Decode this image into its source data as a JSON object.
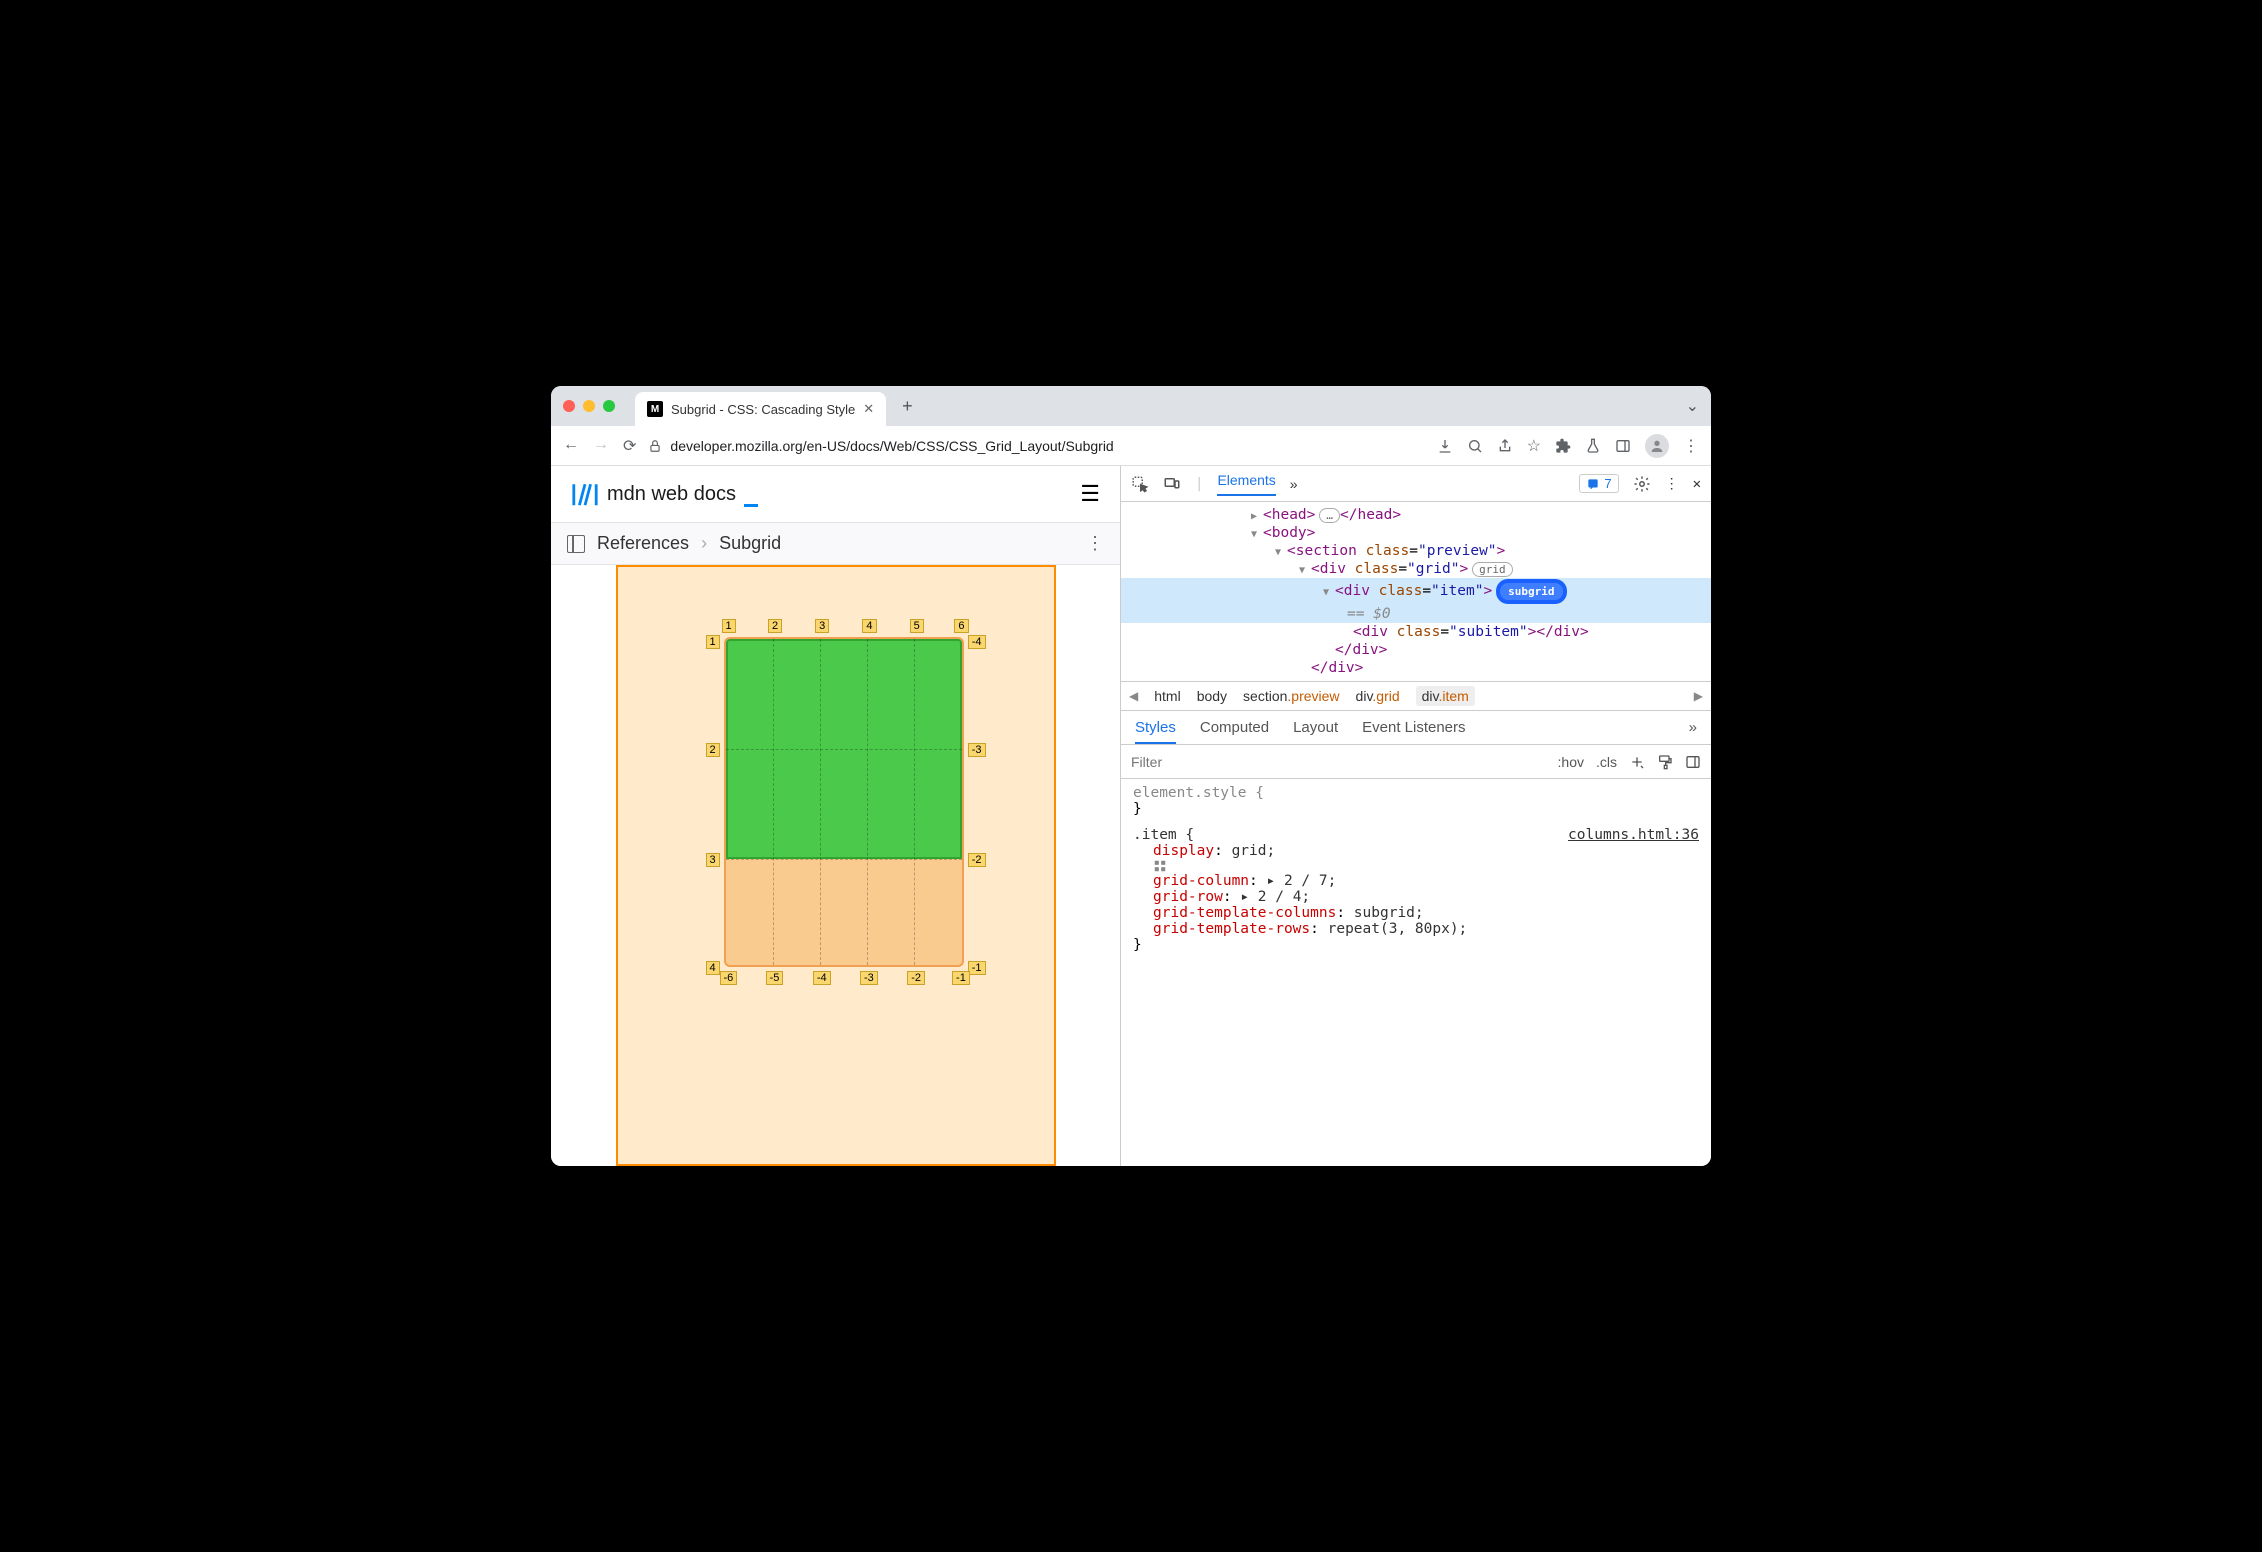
{
  "tab": {
    "title": "Subgrid - CSS: Cascading Style"
  },
  "url": "developer.mozilla.org/en-US/docs/Web/CSS/CSS_Grid_Layout/Subgrid",
  "mdn": {
    "logo_text": "mdn web docs"
  },
  "breadcrumbs": {
    "root": "References",
    "current": "Subgrid"
  },
  "grid_labels": {
    "top": [
      "1",
      "2",
      "3",
      "4",
      "5",
      "6"
    ],
    "left": [
      "1",
      "2",
      "3",
      "4"
    ],
    "right": [
      "-4",
      "-3",
      "-2",
      "-1"
    ],
    "bottom": [
      "-6",
      "-5",
      "-4",
      "-3",
      "-2",
      "-1"
    ]
  },
  "devtools": {
    "header": {
      "elements": "Elements",
      "issues_count": "7"
    },
    "dom": {
      "l1_open": "<head>",
      "l1_dots": "…",
      "l1_close": "</head>",
      "l2": "<body>",
      "l3_open": "<section ",
      "l3_attr_n": "class",
      "l3_attr_v": "\"preview\"",
      "l3_close": ">",
      "l4_open": "<div ",
      "l4_attr_n": "class",
      "l4_attr_v": "\"grid\"",
      "l4_close": ">",
      "l4_badge": "grid",
      "l5_open": "<div ",
      "l5_attr_n": "class",
      "l5_attr_v": "\"item\"",
      "l5_close": ">",
      "l5_badge": "subgrid",
      "l5_eq": "== $0",
      "l6_open": "<div ",
      "l6_attr_n": "class",
      "l6_attr_v": "\"subitem\"",
      "l6_close": "></div>",
      "l7": "</div>",
      "l8": "</div>"
    },
    "crumbs": [
      "html",
      "body",
      "section",
      ".preview",
      "div",
      ".grid",
      "div",
      ".item"
    ],
    "styles_tabs": [
      "Styles",
      "Computed",
      "Layout",
      "Event Listeners"
    ],
    "filter_placeholder": "Filter",
    "hov": ":hov",
    "cls": ".cls",
    "element_style_label": "element.style {",
    "rule": {
      "selector": ".item {",
      "source": "columns.html:36",
      "decls": [
        {
          "p": "display",
          "v": "grid;",
          "icon": true
        },
        {
          "p": "grid-column",
          "v": "▸ 2 / 7;"
        },
        {
          "p": "grid-row",
          "v": "▸ 2 / 4;"
        },
        {
          "p": "grid-template-columns",
          "v": "subgrid;"
        },
        {
          "p": "grid-template-rows",
          "v": "repeat(3, 80px);"
        }
      ],
      "close": "}"
    }
  }
}
